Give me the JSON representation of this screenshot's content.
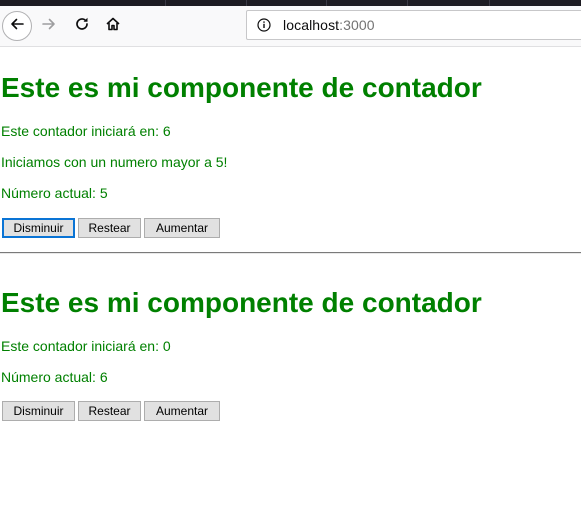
{
  "browser": {
    "url_host": "localhost",
    "url_port": ":3000",
    "icons": {
      "back": "back-arrow-icon",
      "forward": "forward-arrow-icon",
      "reload": "reload-icon",
      "home": "home-icon",
      "info": "info-icon"
    }
  },
  "theme": {
    "text_color": "#008000",
    "focus_color": "#0a74d5"
  },
  "counter1": {
    "title": "Este es mi componente de contador",
    "start_text": "Este contador iniciará en: 6",
    "message": "Iniciamos con un numero mayor a 5!",
    "current_text": "Número actual: 5",
    "decrease_label": "Disminuir",
    "reset_label": "Restear",
    "increase_label": "Aumentar"
  },
  "counter2": {
    "title": "Este es mi componente de contador",
    "start_text": "Este contador iniciará en: 0",
    "current_text": "Número actual: 6",
    "decrease_label": "Disminuir",
    "reset_label": "Restear",
    "increase_label": "Aumentar"
  }
}
